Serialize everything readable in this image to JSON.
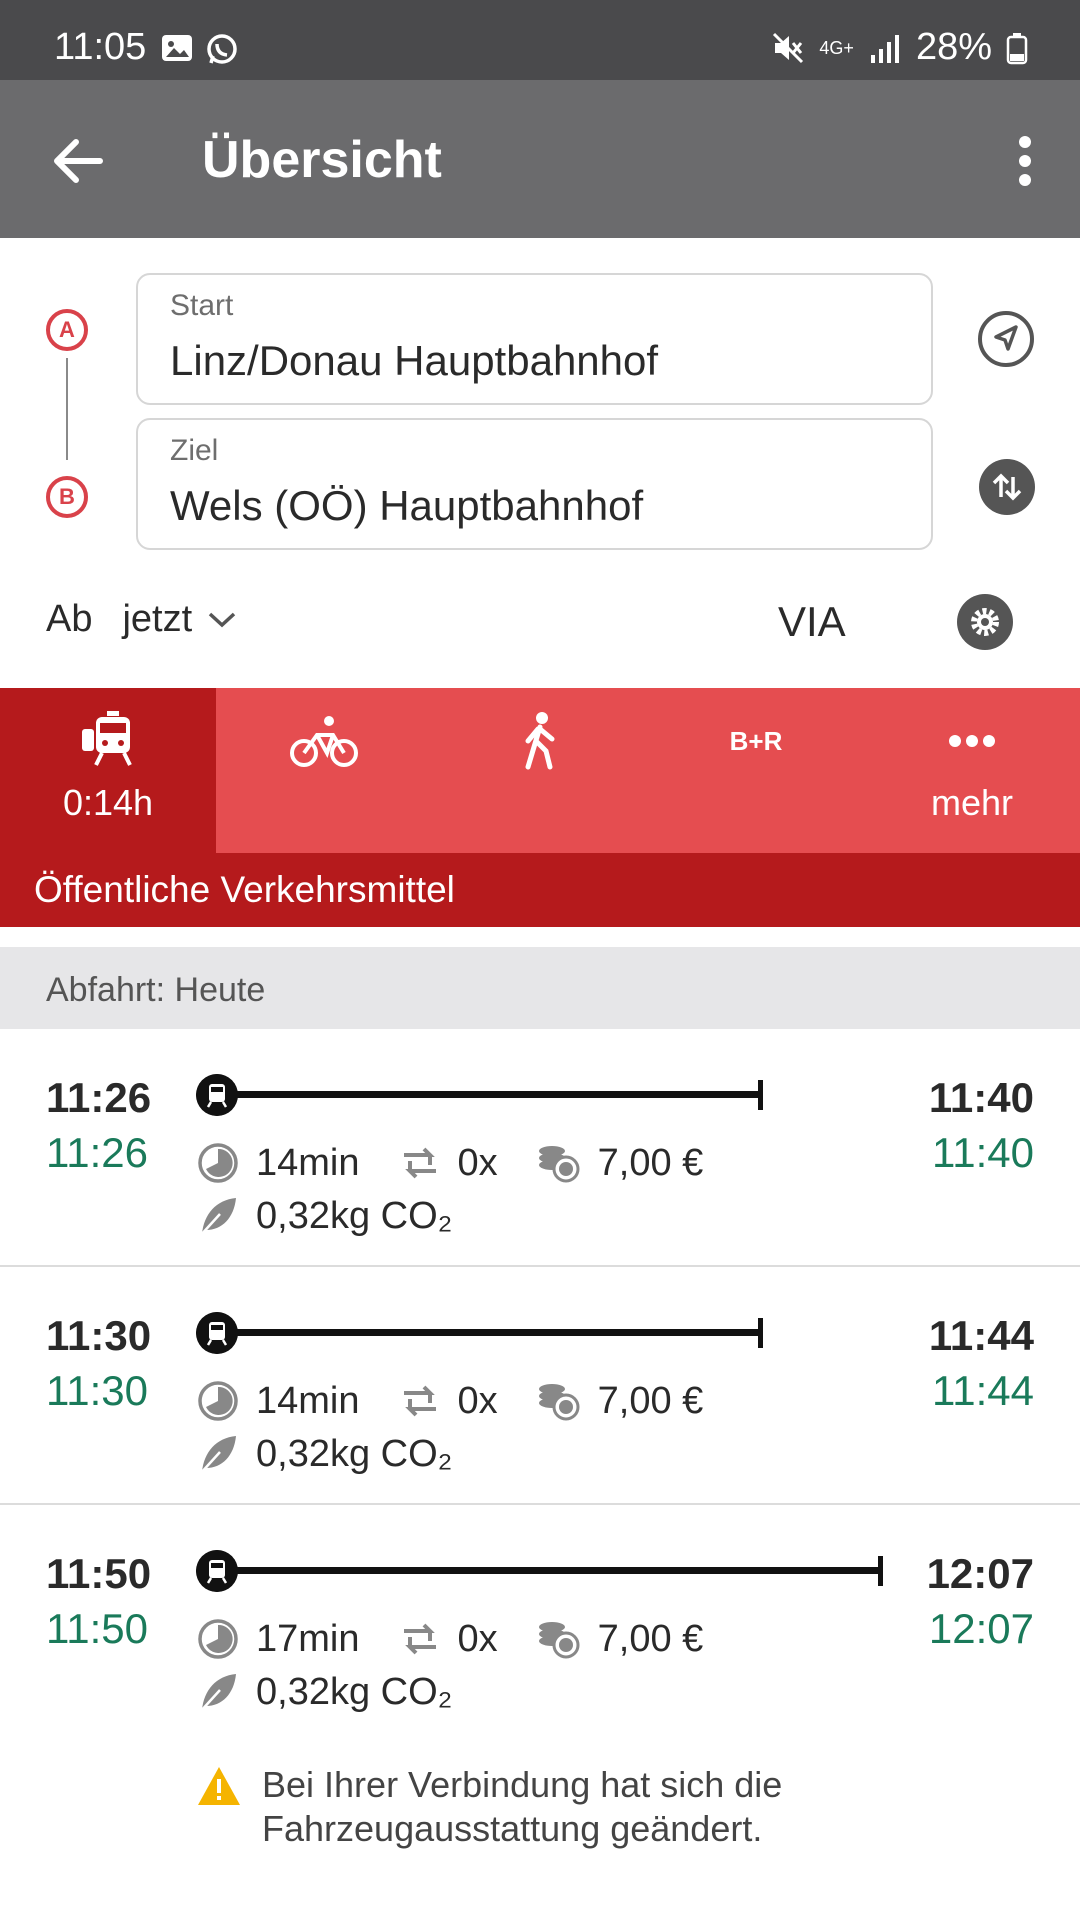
{
  "status_bar": {
    "time": "11:05",
    "network": "4G+",
    "battery": "28%"
  },
  "app_bar": {
    "title": "Übersicht",
    "back_icon": "arrow-left-icon",
    "menu_icon": "more-vertical-icon"
  },
  "form": {
    "marker_a": "A",
    "marker_b": "B",
    "start_label": "Start",
    "start_value": "Linz/Donau Hauptbahnhof",
    "dest_label": "Ziel",
    "dest_value": "Wels (OÖ) Hauptbahnhof",
    "time_prefix": "Ab",
    "time_value": "jetzt",
    "via_label": "VIA"
  },
  "modes": [
    {
      "name": "public-transport",
      "icon": "train-icon",
      "label": "0:14h",
      "active": true
    },
    {
      "name": "bike",
      "icon": "bicycle-icon",
      "label": "",
      "active": false
    },
    {
      "name": "walk",
      "icon": "walking-icon",
      "label": "",
      "active": false
    },
    {
      "name": "bike-and-ride",
      "icon": "b-plus-r-icon",
      "label": "",
      "active": false,
      "icon_text": "B+R"
    },
    {
      "name": "more",
      "icon": "more-horizontal-icon",
      "label": "mehr",
      "active": false
    }
  ],
  "category": "Öffentliche Verkehrsmittel",
  "day_header": "Abfahrt: Heute",
  "journeys": [
    {
      "dep": "11:26",
      "dep_rt": "11:26",
      "arr": "11:40",
      "arr_rt": "11:40",
      "duration": "14min",
      "changes": "0x",
      "price": "7,00 €",
      "co2": "0,32kg CO₂",
      "warning": ""
    },
    {
      "dep": "11:30",
      "dep_rt": "11:30",
      "arr": "11:44",
      "arr_rt": "11:44",
      "duration": "14min",
      "changes": "0x",
      "price": "7,00 €",
      "co2": "0,32kg CO₂",
      "warning": ""
    },
    {
      "dep": "11:50",
      "dep_rt": "11:50",
      "arr": "12:07",
      "arr_rt": "12:07",
      "duration": "17min",
      "changes": "0x",
      "price": "7,00 €",
      "co2": "0,32kg CO₂",
      "warning": "Bei Ihrer Verbindung hat sich die Fahrzeugausstattung geändert."
    }
  ],
  "colors": {
    "status_bar": "#4a4a4c",
    "app_bar": "#6b6b6d",
    "brand_red": "#b51a1c",
    "tab_red": "#e54d50",
    "realtime_green": "#1a7a5a",
    "marker_red": "#d9424a",
    "warning_yellow": "#f5b400"
  }
}
